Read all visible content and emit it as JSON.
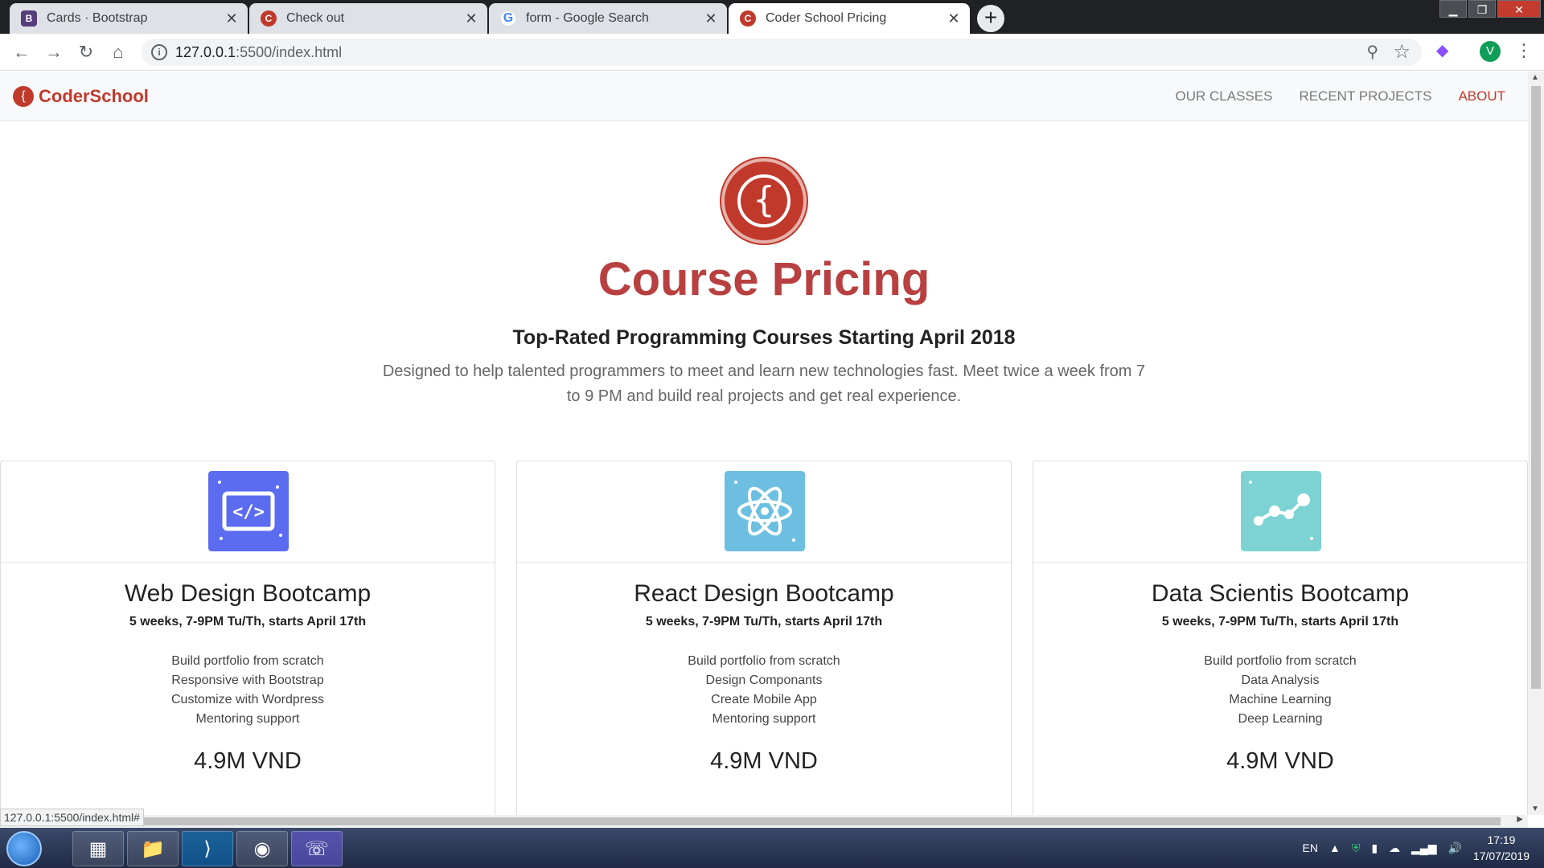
{
  "browser": {
    "tabs": [
      {
        "title": "Cards · Bootstrap",
        "favicon": "bootstrap-icon",
        "active": false
      },
      {
        "title": "Check out",
        "favicon": "coderschool-icon",
        "active": false
      },
      {
        "title": "form - Google Search",
        "favicon": "google-icon",
        "active": false
      },
      {
        "title": "Coder School Pricing",
        "favicon": "coderschool-icon",
        "active": true
      }
    ],
    "new_tab": "+",
    "url_host": "127.0.0.1",
    "url_rest": ":5500/index.html",
    "profile_initial": "V",
    "status_url": "127.0.0.1:5500/index.html#"
  },
  "site": {
    "brand": "CoderSchool",
    "nav": [
      "OUR CLASSES",
      "RECENT PROJECTS",
      "ABOUT"
    ],
    "active_nav": "ABOUT",
    "accent_color": "#c0392b"
  },
  "hero": {
    "title": "Course Pricing",
    "subtitle": "Top-Rated Programming Courses Starting April 2018",
    "description": "Designed to help talented programmers to meet and learn new technologies fast. Meet twice a week from 7 to 9 PM and build real projects and get real experience."
  },
  "cards": [
    {
      "icon": "code-icon",
      "icon_color": "#5b6cf0",
      "title": "Web Design Bootcamp",
      "meta": "5 weeks, 7-9PM Tu/Th, starts April 17th",
      "features": [
        "Build portfolio from scratch",
        "Responsive with Bootstrap",
        "Customize with Wordpress",
        "Mentoring support"
      ],
      "price": "4.9M VND"
    },
    {
      "icon": "react-atom-icon",
      "icon_color": "#6cbfe0",
      "title": "React Design Bootcamp",
      "meta": "5 weeks, 7-9PM Tu/Th, starts April 17th",
      "features": [
        "Build portfolio from scratch",
        "Design Componants",
        "Create Mobile App",
        "Mentoring support"
      ],
      "price": "4.9M VND"
    },
    {
      "icon": "data-graph-icon",
      "icon_color": "#7dd3d3",
      "title": "Data Scientis Bootcamp",
      "meta": "5 weeks, 7-9PM Tu/Th, starts April 17th",
      "features": [
        "Build portfolio from scratch",
        "Data Analysis",
        "Machine Learning",
        "Deep Learning"
      ],
      "price": "4.9M VND"
    }
  ],
  "taskbar": {
    "language": "EN",
    "time": "17:19",
    "date": "17/07/2019"
  }
}
